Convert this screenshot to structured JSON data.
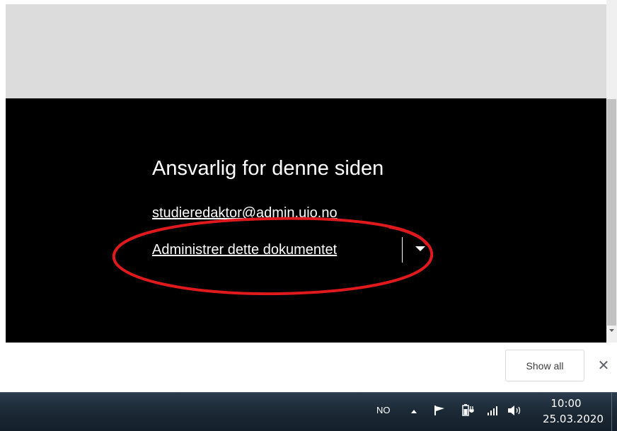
{
  "footer": {
    "title": "Ansvarlig for denne siden",
    "email": "studieredaktor@admin.uio.no",
    "admin_link": "Administrer dette dokumentet",
    "dropdown_icon": "caret-down-icon"
  },
  "annotation": {
    "color": "#e0191c"
  },
  "download_bar": {
    "show_all_label": "Show all",
    "close_label": "✕"
  },
  "taskbar": {
    "language": "NO",
    "tray_icons": [
      "chevron-up-icon",
      "flag-icon",
      "power-icon",
      "signal-icon",
      "volume-icon"
    ],
    "time": "10:00",
    "date": "25.03.2020"
  },
  "colors": {
    "footer_bg": "#000000",
    "page_band": "#dcdcdc",
    "taskbar": "#1c2a37"
  }
}
